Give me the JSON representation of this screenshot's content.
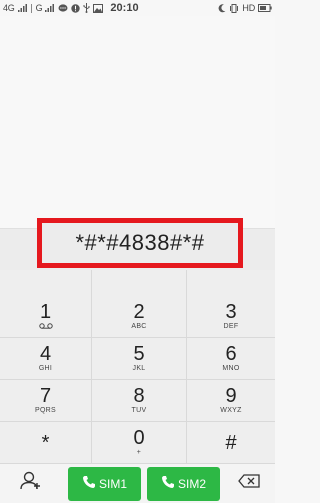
{
  "status_bar": {
    "sim1_signal": "4G",
    "sim2_signal": "G",
    "time": "20:10",
    "hd_label": "HD"
  },
  "dialer": {
    "number": "*#*#4838#*#",
    "keys": [
      {
        "digit": "1",
        "letters": "",
        "icon": "voicemail-icon"
      },
      {
        "digit": "2",
        "letters": "ABC"
      },
      {
        "digit": "3",
        "letters": "DEF"
      },
      {
        "digit": "4",
        "letters": "GHI"
      },
      {
        "digit": "5",
        "letters": "JKL"
      },
      {
        "digit": "6",
        "letters": "MNO"
      },
      {
        "digit": "7",
        "letters": "PQRS"
      },
      {
        "digit": "8",
        "letters": "TUV"
      },
      {
        "digit": "9",
        "letters": "WXYZ"
      },
      {
        "digit": "*",
        "letters": ""
      },
      {
        "digit": "0",
        "letters": "+"
      },
      {
        "digit": "#",
        "letters": ""
      }
    ]
  },
  "actions": {
    "sim1_label": "SIM1",
    "sim2_label": "SIM2"
  },
  "colors": {
    "accent_green": "#2db845",
    "highlight_red": "#e5181e"
  }
}
